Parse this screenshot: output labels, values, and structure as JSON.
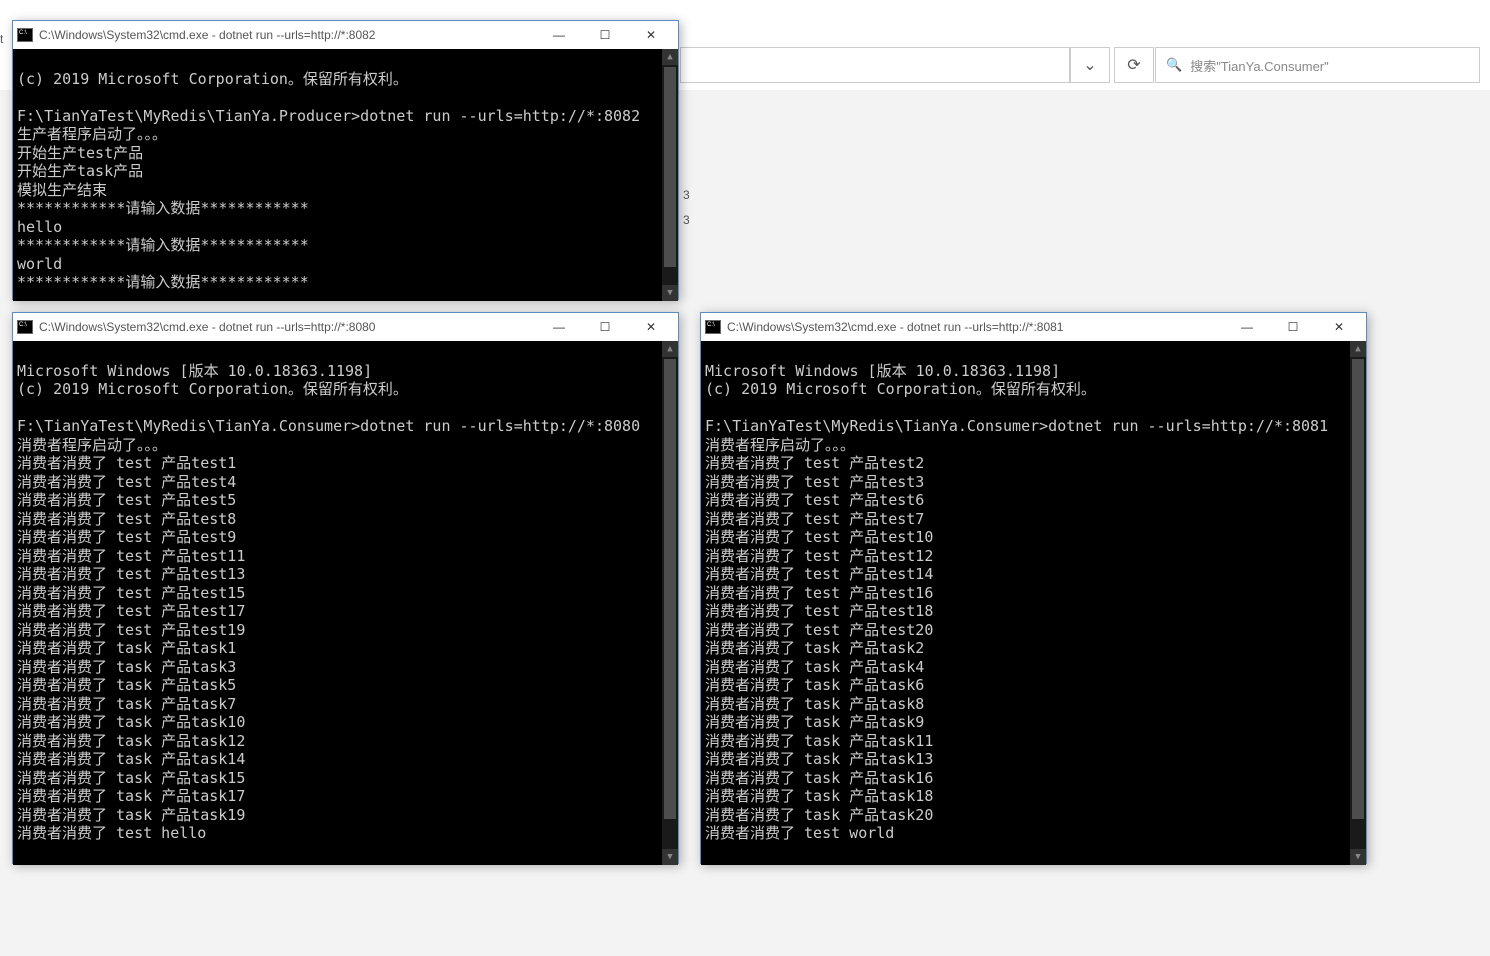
{
  "explorer": {
    "search_placeholder": "搜索\"TianYa.Consumer\"",
    "chevron": "⌄",
    "refresh": "⟳",
    "search_icon": "🔍",
    "bg_items": [
      "3",
      "3"
    ]
  },
  "partial": {
    "l1": "t"
  },
  "win1": {
    "title": "C:\\Windows\\System32\\cmd.exe - dotnet  run --urls=http://*:8082",
    "lines": [
      "(c) 2019 Microsoft Corporation。保留所有权利。",
      "",
      "F:\\TianYaTest\\MyRedis\\TianYa.Producer>dotnet run --urls=http://*:8082",
      "生产者程序启动了。。。",
      "开始生产test产品",
      "开始生产task产品",
      "模拟生产结束",
      "************请输入数据************",
      "hello",
      "************请输入数据************",
      "world",
      "************请输入数据************"
    ]
  },
  "win2": {
    "title": "C:\\Windows\\System32\\cmd.exe - dotnet  run --urls=http://*:8080",
    "lines": [
      "Microsoft Windows [版本 10.0.18363.1198]",
      "(c) 2019 Microsoft Corporation。保留所有权利。",
      "",
      "F:\\TianYaTest\\MyRedis\\TianYa.Consumer>dotnet run --urls=http://*:8080",
      "消费者程序启动了。。。",
      "消费者消费了 test 产品test1",
      "消费者消费了 test 产品test4",
      "消费者消费了 test 产品test5",
      "消费者消费了 test 产品test8",
      "消费者消费了 test 产品test9",
      "消费者消费了 test 产品test11",
      "消费者消费了 test 产品test13",
      "消费者消费了 test 产品test15",
      "消费者消费了 test 产品test17",
      "消费者消费了 test 产品test19",
      "消费者消费了 task 产品task1",
      "消费者消费了 task 产品task3",
      "消费者消费了 task 产品task5",
      "消费者消费了 task 产品task7",
      "消费者消费了 task 产品task10",
      "消费者消费了 task 产品task12",
      "消费者消费了 task 产品task14",
      "消费者消费了 task 产品task15",
      "消费者消费了 task 产品task17",
      "消费者消费了 task 产品task19",
      "消费者消费了 test hello"
    ]
  },
  "win3": {
    "title": "C:\\Windows\\System32\\cmd.exe - dotnet  run --urls=http://*:8081",
    "lines": [
      "Microsoft Windows [版本 10.0.18363.1198]",
      "(c) 2019 Microsoft Corporation。保留所有权利。",
      "",
      "F:\\TianYaTest\\MyRedis\\TianYa.Consumer>dotnet run --urls=http://*:8081",
      "消费者程序启动了。。。",
      "消费者消费了 test 产品test2",
      "消费者消费了 test 产品test3",
      "消费者消费了 test 产品test6",
      "消费者消费了 test 产品test7",
      "消费者消费了 test 产品test10",
      "消费者消费了 test 产品test12",
      "消费者消费了 test 产品test14",
      "消费者消费了 test 产品test16",
      "消费者消费了 test 产品test18",
      "消费者消费了 test 产品test20",
      "消费者消费了 task 产品task2",
      "消费者消费了 task 产品task4",
      "消费者消费了 task 产品task6",
      "消费者消费了 task 产品task8",
      "消费者消费了 task 产品task9",
      "消费者消费了 task 产品task11",
      "消费者消费了 task 产品task13",
      "消费者消费了 task 产品task16",
      "消费者消费了 task 产品task18",
      "消费者消费了 task 产品task20",
      "消费者消费了 test world"
    ]
  },
  "btns": {
    "min": "—",
    "max": "☐",
    "close": "✕"
  }
}
